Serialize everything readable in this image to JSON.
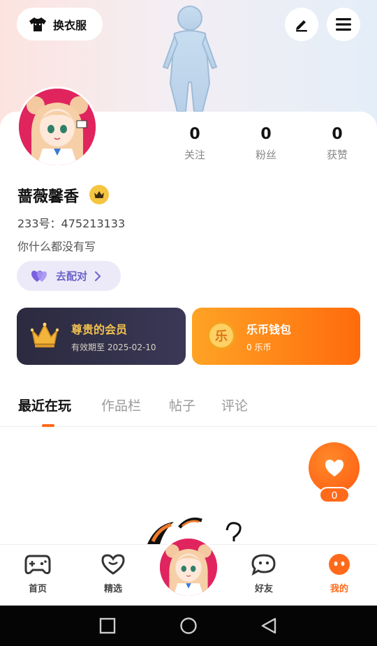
{
  "header": {
    "outfit_button_label": "换衣服"
  },
  "profile": {
    "name": "蔷薇馨香",
    "uid_line": "233号：475213133",
    "bio": "你什么都没有写",
    "match_button_label": "去配对"
  },
  "stats": [
    {
      "value": "0",
      "label": "关注"
    },
    {
      "value": "0",
      "label": "粉丝"
    },
    {
      "value": "0",
      "label": "获赞"
    }
  ],
  "vip": {
    "title": "尊贵的会员",
    "subtitle": "有效期至 2025-02-10"
  },
  "wallet": {
    "title": "乐币钱包",
    "subtitle": "0 乐币",
    "coin_char": "乐"
  },
  "tabs": [
    "最近在玩",
    "作品栏",
    "帖子",
    "评论"
  ],
  "like": {
    "count": "0"
  },
  "nav": {
    "home": "首页",
    "featured": "精选",
    "friends": "好友",
    "mine": "我的"
  },
  "colors": {
    "accent": "#ff6a1a",
    "vip_bg": "#2b2a3f",
    "match_text": "#6d62c9"
  }
}
